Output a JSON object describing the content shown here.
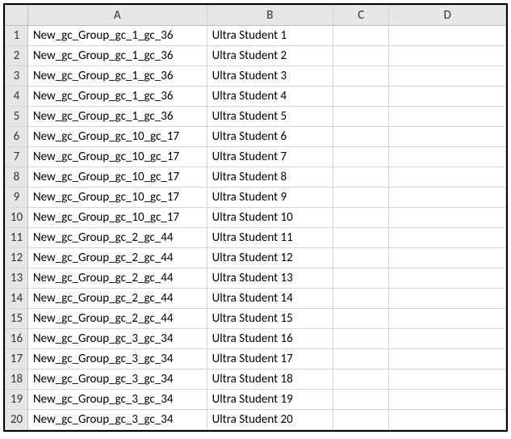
{
  "columns": [
    "A",
    "B",
    "C",
    "D"
  ],
  "rows": [
    {
      "num": "1",
      "a": "New_gc_Group_gc_1_gc_36",
      "b": "Ultra Student 1",
      "c": "",
      "d": ""
    },
    {
      "num": "2",
      "a": "New_gc_Group_gc_1_gc_36",
      "b": "Ultra Student 2",
      "c": "",
      "d": ""
    },
    {
      "num": "3",
      "a": "New_gc_Group_gc_1_gc_36",
      "b": "Ultra Student 3",
      "c": "",
      "d": ""
    },
    {
      "num": "4",
      "a": "New_gc_Group_gc_1_gc_36",
      "b": "Ultra Student 4",
      "c": "",
      "d": ""
    },
    {
      "num": "5",
      "a": "New_gc_Group_gc_1_gc_36",
      "b": "Ultra Student 5",
      "c": "",
      "d": ""
    },
    {
      "num": "6",
      "a": "New_gc_Group_gc_10_gc_17",
      "b": "Ultra Student 6",
      "c": "",
      "d": ""
    },
    {
      "num": "7",
      "a": "New_gc_Group_gc_10_gc_17",
      "b": "Ultra Student 7",
      "c": "",
      "d": ""
    },
    {
      "num": "8",
      "a": "New_gc_Group_gc_10_gc_17",
      "b": "Ultra Student 8",
      "c": "",
      "d": ""
    },
    {
      "num": "9",
      "a": "New_gc_Group_gc_10_gc_17",
      "b": "Ultra Student 9",
      "c": "",
      "d": ""
    },
    {
      "num": "10",
      "a": "New_gc_Group_gc_10_gc_17",
      "b": "Ultra Student 10",
      "c": "",
      "d": ""
    },
    {
      "num": "11",
      "a": "New_gc_Group_gc_2_gc_44",
      "b": "Ultra Student 11",
      "c": "",
      "d": ""
    },
    {
      "num": "12",
      "a": "New_gc_Group_gc_2_gc_44",
      "b": "Ultra Student 12",
      "c": "",
      "d": ""
    },
    {
      "num": "13",
      "a": "New_gc_Group_gc_2_gc_44",
      "b": "Ultra Student 13",
      "c": "",
      "d": ""
    },
    {
      "num": "14",
      "a": "New_gc_Group_gc_2_gc_44",
      "b": "Ultra Student 14",
      "c": "",
      "d": ""
    },
    {
      "num": "15",
      "a": "New_gc_Group_gc_2_gc_44",
      "b": "Ultra Student 15",
      "c": "",
      "d": ""
    },
    {
      "num": "16",
      "a": "New_gc_Group_gc_3_gc_34",
      "b": "Ultra Student 16",
      "c": "",
      "d": ""
    },
    {
      "num": "17",
      "a": "New_gc_Group_gc_3_gc_34",
      "b": "Ultra Student 17",
      "c": "",
      "d": ""
    },
    {
      "num": "18",
      "a": "New_gc_Group_gc_3_gc_34",
      "b": "Ultra Student 18",
      "c": "",
      "d": ""
    },
    {
      "num": "19",
      "a": "New_gc_Group_gc_3_gc_34",
      "b": "Ultra Student 19",
      "c": "",
      "d": ""
    },
    {
      "num": "20",
      "a": "New_gc_Group_gc_3_gc_34",
      "b": "Ultra Student 20",
      "c": "",
      "d": ""
    }
  ]
}
